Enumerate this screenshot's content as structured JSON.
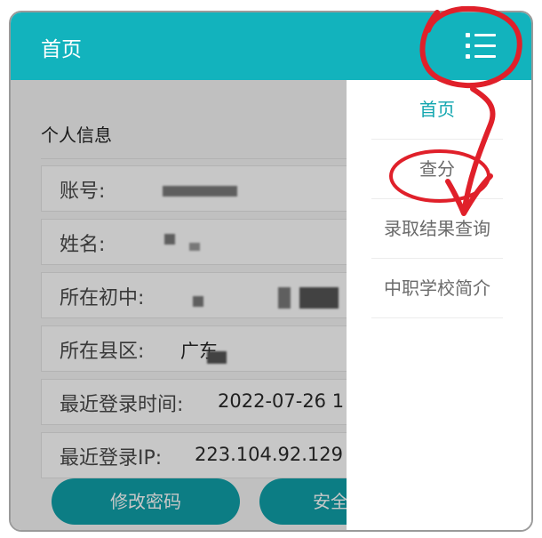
{
  "header": {
    "title": "首页",
    "menu_icon": "menu-list-icon"
  },
  "personal_info": {
    "section_title": "个人信息",
    "rows": [
      {
        "label": "账号:",
        "value": ""
      },
      {
        "label": "姓名:",
        "value": ""
      },
      {
        "label": "所在初中:",
        "value": ""
      },
      {
        "label": "所在县区:",
        "value": "广东"
      },
      {
        "label": "最近登录时间:",
        "value": "2022-07-26 1"
      },
      {
        "label": "最近登录IP:",
        "value": "223.104.92.129"
      }
    ]
  },
  "buttons": {
    "change_password": "修改密码",
    "security": "安全"
  },
  "drawer": {
    "items": [
      {
        "label": "首页",
        "active": true
      },
      {
        "label": "查分",
        "active": false
      },
      {
        "label": "录取结果查询",
        "active": false
      },
      {
        "label": "中职学校简介",
        "active": false
      }
    ]
  },
  "colors": {
    "header": "#12b3bd",
    "button": "#10a1a9",
    "active_item": "#12a6af",
    "annotation": "#e0202a"
  }
}
